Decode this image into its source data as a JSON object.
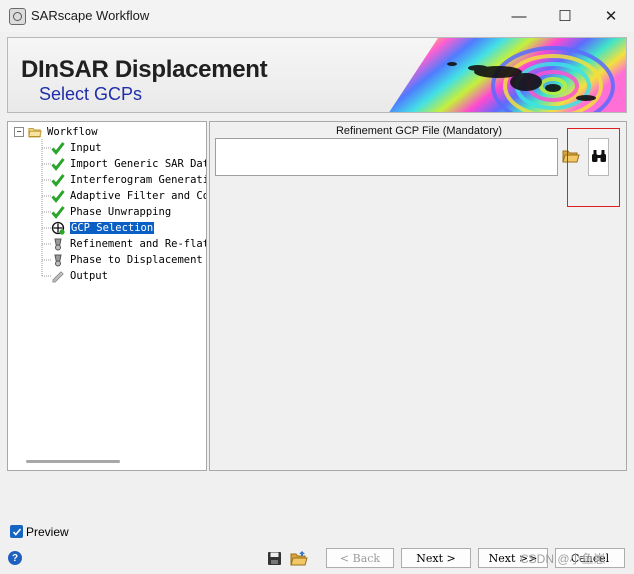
{
  "window": {
    "title": "SARscape Workflow",
    "minimize_glyph": "—",
    "maximize_glyph": "☐",
    "close_glyph": "✕"
  },
  "banner": {
    "title": "DInSAR Displacement",
    "subtitle": "Select GCPs"
  },
  "tree": {
    "root_label": "Workflow",
    "items": [
      {
        "label": "Input",
        "status": "done"
      },
      {
        "label": "Import Generic SAR Data",
        "status": "done"
      },
      {
        "label": "Interferogram Generation",
        "status": "done"
      },
      {
        "label": "Adaptive Filter and Coherence",
        "status": "done"
      },
      {
        "label": "Phase Unwrapping",
        "status": "done"
      },
      {
        "label": "GCP Selection",
        "status": "current"
      },
      {
        "label": "Refinement and Re-flattening",
        "status": "pending"
      },
      {
        "label": "Phase to Displacement Conversion",
        "status": "pending"
      },
      {
        "label": "Output",
        "status": "output"
      }
    ]
  },
  "main": {
    "gcp_file_label": "Refinement GCP File (Mandatory)",
    "gcp_file_value": ""
  },
  "footer": {
    "preview_label": "Preview",
    "preview_checked": true,
    "help_glyph": "?",
    "back_label": "< Back",
    "next_label": "Next >",
    "next_next_label": "Next >>",
    "cancel_label": "Cancel",
    "watermark": "CSDN @小鱼崽"
  },
  "colors": {
    "selection": "#0a5fc4",
    "banner_subtitle": "#1f2ea8",
    "check_green": "#2aa62a",
    "highlight_red": "#e02020"
  }
}
